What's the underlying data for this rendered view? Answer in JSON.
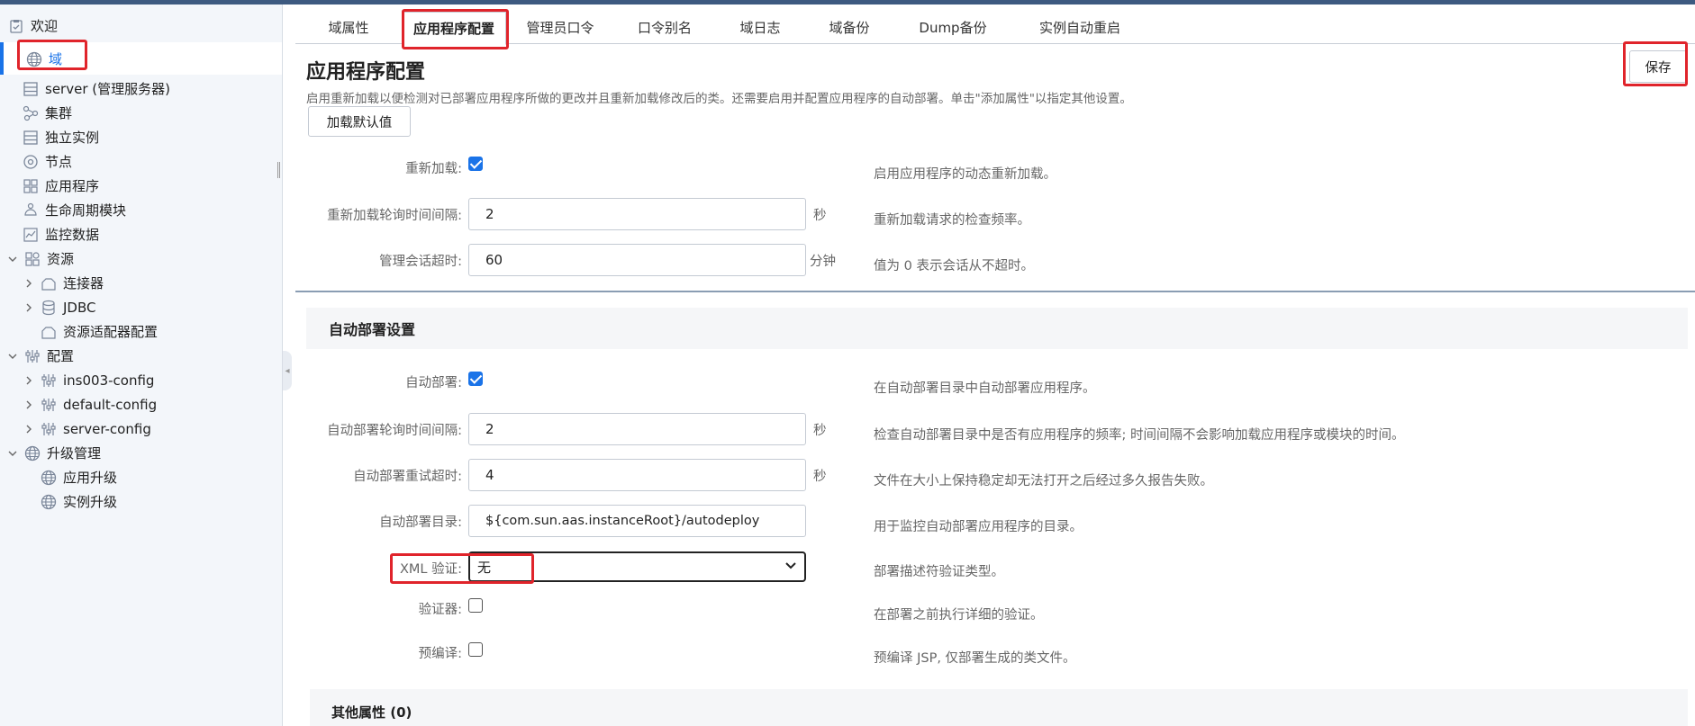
{
  "sidebar": {
    "items": [
      {
        "label": "欢迎",
        "icon": "welcome-icon"
      },
      {
        "label": "域",
        "icon": "globe-icon"
      },
      {
        "label": "server (管理服务器)",
        "icon": "server-icon"
      },
      {
        "label": "集群",
        "icon": "cluster-icon"
      },
      {
        "label": "独立实例",
        "icon": "instance-icon"
      },
      {
        "label": "节点",
        "icon": "node-icon"
      },
      {
        "label": "应用程序",
        "icon": "applications-icon"
      },
      {
        "label": "生命周期模块",
        "icon": "lifecycle-icon"
      },
      {
        "label": "监控数据",
        "icon": "monitoring-icon"
      },
      {
        "label": "资源",
        "icon": "resources-icon"
      },
      {
        "label": "连接器",
        "icon": "connector-icon"
      },
      {
        "label": "JDBC",
        "icon": "database-icon"
      },
      {
        "label": "资源适配器配置",
        "icon": "adapter-icon"
      },
      {
        "label": "配置",
        "icon": "config-icon"
      },
      {
        "label": "ins003-config",
        "icon": "config-icon"
      },
      {
        "label": "default-config",
        "icon": "config-icon"
      },
      {
        "label": "server-config",
        "icon": "config-icon"
      },
      {
        "label": "升级管理",
        "icon": "globe-icon"
      },
      {
        "label": "应用升级",
        "icon": "globe-icon"
      },
      {
        "label": "实例升级",
        "icon": "globe-icon"
      }
    ]
  },
  "tabs": [
    {
      "label": "域属性"
    },
    {
      "label": "应用程序配置"
    },
    {
      "label": "管理员口令"
    },
    {
      "label": "口令别名"
    },
    {
      "label": "域日志"
    },
    {
      "label": "域备份"
    },
    {
      "label": "Dump备份"
    },
    {
      "label": "实例自动重启"
    }
  ],
  "page": {
    "title": "应用程序配置",
    "description": "启用重新加载以便检测对已部署应用程序所做的更改并且重新加载修改后的类。还需要启用并配置应用程序的自动部署。单击\"添加属性\"以指定其他设置。",
    "load_defaults": "加载默认值",
    "save": "保存"
  },
  "reload": {
    "enabled_label": "重新加载:",
    "enabled_help": "启用应用程序的动态重新加载。",
    "interval_label": "重新加载轮询时间间隔:",
    "interval_value": "2",
    "interval_unit": "秒",
    "interval_help": "重新加载请求的检查频率。",
    "timeout_label": "管理会话超时:",
    "timeout_value": "60",
    "timeout_unit": "分钟",
    "timeout_help": "值为 0 表示会话从不超时。"
  },
  "autodeploy": {
    "section_title": "自动部署设置",
    "enabled_label": "自动部署:",
    "enabled_help": "在自动部署目录中自动部署应用程序。",
    "interval_label": "自动部署轮询时间间隔:",
    "interval_value": "2",
    "interval_unit": "秒",
    "interval_help": "检查自动部署目录中是否有应用程序的频率; 时间间隔不会影响加载应用程序或模块的时间。",
    "retry_label": "自动部署重试超时:",
    "retry_value": "4",
    "retry_unit": "秒",
    "retry_help": "文件在大小上保持稳定却无法打开之后经过多久报告失败。",
    "dir_label": "自动部署目录:",
    "dir_value": "${com.sun.aas.instanceRoot}/autodeploy",
    "dir_help": "用于监控自动部署应用程序的目录。",
    "xml_label": "XML 验证:",
    "xml_value": "无",
    "xml_help": "部署描述符验证类型。",
    "verifier_label": "验证器:",
    "verifier_help": "在部署之前执行详细的验证。",
    "precompile_label": "预编译:",
    "precompile_help": "预编译 JSP, 仅部署生成的类文件。"
  },
  "other": {
    "title": "其他属性 (0)"
  }
}
